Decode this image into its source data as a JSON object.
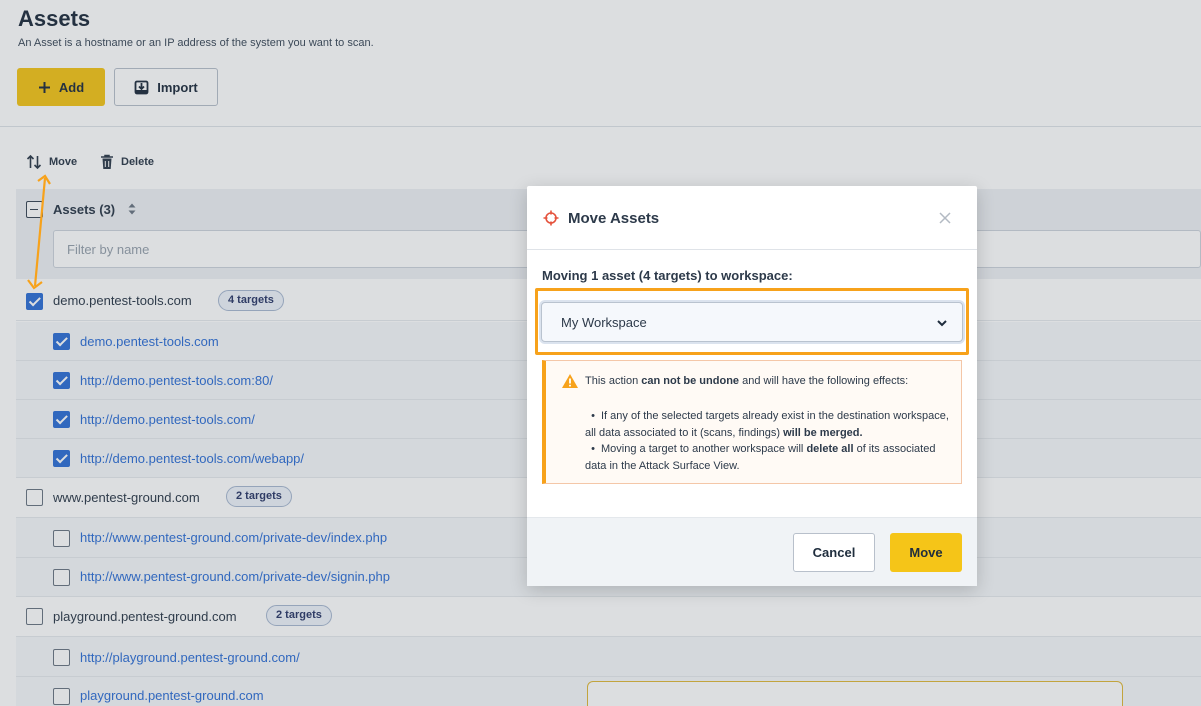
{
  "page": {
    "title": "Assets",
    "subtitle": "An Asset is a hostname or an IP address of the system you want to scan.",
    "add_label": "Add",
    "import_label": "Import"
  },
  "toolbar": {
    "move_label": "Move",
    "delete_label": "Delete"
  },
  "table": {
    "header_label": "Assets (3)",
    "filter_placeholder": "Filter by name",
    "groups": [
      {
        "host": "demo.pentest-tools.com",
        "badge": "4 targets",
        "checked": true,
        "targets": [
          {
            "url": "demo.pentest-tools.com",
            "checked": true
          },
          {
            "url": "http://demo.pentest-tools.com:80/",
            "checked": true
          },
          {
            "url": "http://demo.pentest-tools.com/",
            "checked": true
          },
          {
            "url": "http://demo.pentest-tools.com/webapp/",
            "checked": true
          }
        ]
      },
      {
        "host": "www.pentest-ground.com",
        "badge": "2 targets",
        "checked": false,
        "targets": [
          {
            "url": "http://www.pentest-ground.com/private-dev/index.php",
            "checked": false
          },
          {
            "url": "http://www.pentest-ground.com/private-dev/signin.php",
            "checked": false
          }
        ]
      },
      {
        "host": "playground.pentest-ground.com",
        "badge": "2 targets",
        "checked": false,
        "targets": [
          {
            "url": "http://playground.pentest-ground.com/",
            "checked": false
          },
          {
            "url": "playground.pentest-ground.com",
            "checked": false
          }
        ]
      }
    ]
  },
  "modal": {
    "title": "Move Assets",
    "label": "Moving 1 asset (4 targets) to workspace:",
    "selected_workspace": "My Workspace",
    "warning": {
      "intro_prefix": "This action ",
      "intro_bold": "can not be undone",
      "intro_suffix": " and will have the following effects:",
      "item1_prefix": "If any of the selected targets already exist in the destination workspace, all data associated to it (scans, findings) ",
      "item1_bold": "will be merged.",
      "item2_prefix": "Moving a target to another workspace will ",
      "item2_bold": "delete all",
      "item2_suffix": " of its associated data in the Attack Surface View."
    },
    "cancel_label": "Cancel",
    "move_label": "Move"
  },
  "colors": {
    "accent_yellow": "#f5c518",
    "highlight_orange": "#f7a21b",
    "link_blue": "#2f6fd6",
    "title_icon_red": "#e5533d"
  }
}
